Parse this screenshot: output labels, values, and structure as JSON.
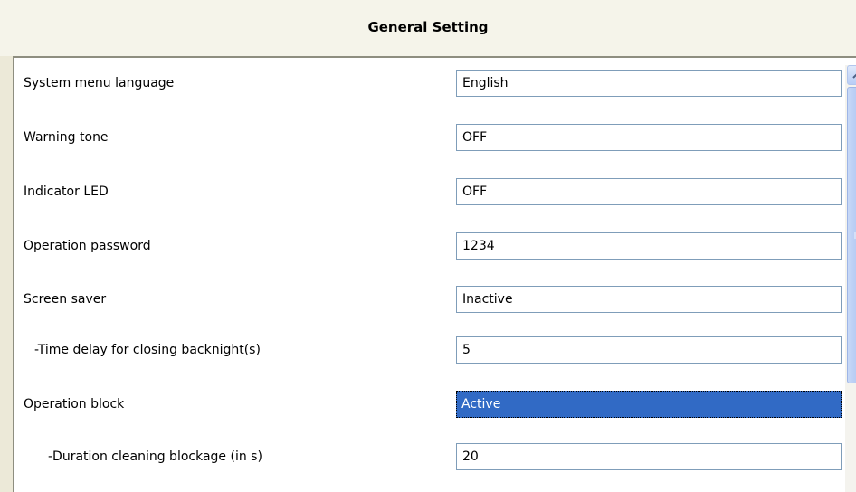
{
  "window": {
    "title": "General Setting"
  },
  "settings": [
    {
      "label": "System menu language",
      "value": "English"
    },
    {
      "label": "Warning tone",
      "value": "OFF"
    },
    {
      "label": "Indicator LED",
      "value": "OFF"
    },
    {
      "label": "Operation password",
      "value": "1234"
    },
    {
      "label": "Screen saver",
      "value": "Inactive"
    },
    {
      "label": "-Time delay for closing backnight(s)",
      "value": "5"
    },
    {
      "label": "Operation block",
      "value": "Active",
      "selected": true
    },
    {
      "label": "-Duration cleaning blockage (in s)",
      "value": "20"
    }
  ],
  "icons": {
    "scroll_up": "chevron-up-icon",
    "thumb_grip": "grip-icon"
  },
  "colors": {
    "selection": "#316ac5",
    "field_border": "#7f9db9",
    "header_bg": "#f5f4ea"
  }
}
